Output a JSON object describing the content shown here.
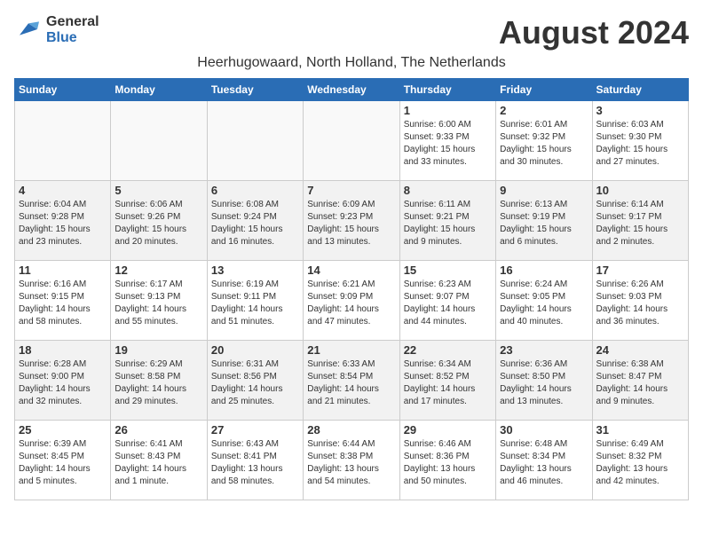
{
  "header": {
    "logo_general": "General",
    "logo_blue": "Blue",
    "month_title": "August 2024",
    "subtitle": "Heerhugowaard, North Holland, The Netherlands"
  },
  "weekdays": [
    "Sunday",
    "Monday",
    "Tuesday",
    "Wednesday",
    "Thursday",
    "Friday",
    "Saturday"
  ],
  "weeks": [
    [
      {
        "day": "",
        "info": "",
        "empty": true
      },
      {
        "day": "",
        "info": "",
        "empty": true
      },
      {
        "day": "",
        "info": "",
        "empty": true
      },
      {
        "day": "",
        "info": "",
        "empty": true
      },
      {
        "day": "1",
        "info": "Sunrise: 6:00 AM\nSunset: 9:33 PM\nDaylight: 15 hours\nand 33 minutes."
      },
      {
        "day": "2",
        "info": "Sunrise: 6:01 AM\nSunset: 9:32 PM\nDaylight: 15 hours\nand 30 minutes."
      },
      {
        "day": "3",
        "info": "Sunrise: 6:03 AM\nSunset: 9:30 PM\nDaylight: 15 hours\nand 27 minutes."
      }
    ],
    [
      {
        "day": "4",
        "info": "Sunrise: 6:04 AM\nSunset: 9:28 PM\nDaylight: 15 hours\nand 23 minutes."
      },
      {
        "day": "5",
        "info": "Sunrise: 6:06 AM\nSunset: 9:26 PM\nDaylight: 15 hours\nand 20 minutes."
      },
      {
        "day": "6",
        "info": "Sunrise: 6:08 AM\nSunset: 9:24 PM\nDaylight: 15 hours\nand 16 minutes."
      },
      {
        "day": "7",
        "info": "Sunrise: 6:09 AM\nSunset: 9:23 PM\nDaylight: 15 hours\nand 13 minutes."
      },
      {
        "day": "8",
        "info": "Sunrise: 6:11 AM\nSunset: 9:21 PM\nDaylight: 15 hours\nand 9 minutes."
      },
      {
        "day": "9",
        "info": "Sunrise: 6:13 AM\nSunset: 9:19 PM\nDaylight: 15 hours\nand 6 minutes."
      },
      {
        "day": "10",
        "info": "Sunrise: 6:14 AM\nSunset: 9:17 PM\nDaylight: 15 hours\nand 2 minutes."
      }
    ],
    [
      {
        "day": "11",
        "info": "Sunrise: 6:16 AM\nSunset: 9:15 PM\nDaylight: 14 hours\nand 58 minutes."
      },
      {
        "day": "12",
        "info": "Sunrise: 6:17 AM\nSunset: 9:13 PM\nDaylight: 14 hours\nand 55 minutes."
      },
      {
        "day": "13",
        "info": "Sunrise: 6:19 AM\nSunset: 9:11 PM\nDaylight: 14 hours\nand 51 minutes."
      },
      {
        "day": "14",
        "info": "Sunrise: 6:21 AM\nSunset: 9:09 PM\nDaylight: 14 hours\nand 47 minutes."
      },
      {
        "day": "15",
        "info": "Sunrise: 6:23 AM\nSunset: 9:07 PM\nDaylight: 14 hours\nand 44 minutes."
      },
      {
        "day": "16",
        "info": "Sunrise: 6:24 AM\nSunset: 9:05 PM\nDaylight: 14 hours\nand 40 minutes."
      },
      {
        "day": "17",
        "info": "Sunrise: 6:26 AM\nSunset: 9:03 PM\nDaylight: 14 hours\nand 36 minutes."
      }
    ],
    [
      {
        "day": "18",
        "info": "Sunrise: 6:28 AM\nSunset: 9:00 PM\nDaylight: 14 hours\nand 32 minutes."
      },
      {
        "day": "19",
        "info": "Sunrise: 6:29 AM\nSunset: 8:58 PM\nDaylight: 14 hours\nand 29 minutes."
      },
      {
        "day": "20",
        "info": "Sunrise: 6:31 AM\nSunset: 8:56 PM\nDaylight: 14 hours\nand 25 minutes."
      },
      {
        "day": "21",
        "info": "Sunrise: 6:33 AM\nSunset: 8:54 PM\nDaylight: 14 hours\nand 21 minutes."
      },
      {
        "day": "22",
        "info": "Sunrise: 6:34 AM\nSunset: 8:52 PM\nDaylight: 14 hours\nand 17 minutes."
      },
      {
        "day": "23",
        "info": "Sunrise: 6:36 AM\nSunset: 8:50 PM\nDaylight: 14 hours\nand 13 minutes."
      },
      {
        "day": "24",
        "info": "Sunrise: 6:38 AM\nSunset: 8:47 PM\nDaylight: 14 hours\nand 9 minutes."
      }
    ],
    [
      {
        "day": "25",
        "info": "Sunrise: 6:39 AM\nSunset: 8:45 PM\nDaylight: 14 hours\nand 5 minutes."
      },
      {
        "day": "26",
        "info": "Sunrise: 6:41 AM\nSunset: 8:43 PM\nDaylight: 14 hours\nand 1 minute."
      },
      {
        "day": "27",
        "info": "Sunrise: 6:43 AM\nSunset: 8:41 PM\nDaylight: 13 hours\nand 58 minutes."
      },
      {
        "day": "28",
        "info": "Sunrise: 6:44 AM\nSunset: 8:38 PM\nDaylight: 13 hours\nand 54 minutes."
      },
      {
        "day": "29",
        "info": "Sunrise: 6:46 AM\nSunset: 8:36 PM\nDaylight: 13 hours\nand 50 minutes."
      },
      {
        "day": "30",
        "info": "Sunrise: 6:48 AM\nSunset: 8:34 PM\nDaylight: 13 hours\nand 46 minutes."
      },
      {
        "day": "31",
        "info": "Sunrise: 6:49 AM\nSunset: 8:32 PM\nDaylight: 13 hours\nand 42 minutes."
      }
    ]
  ]
}
